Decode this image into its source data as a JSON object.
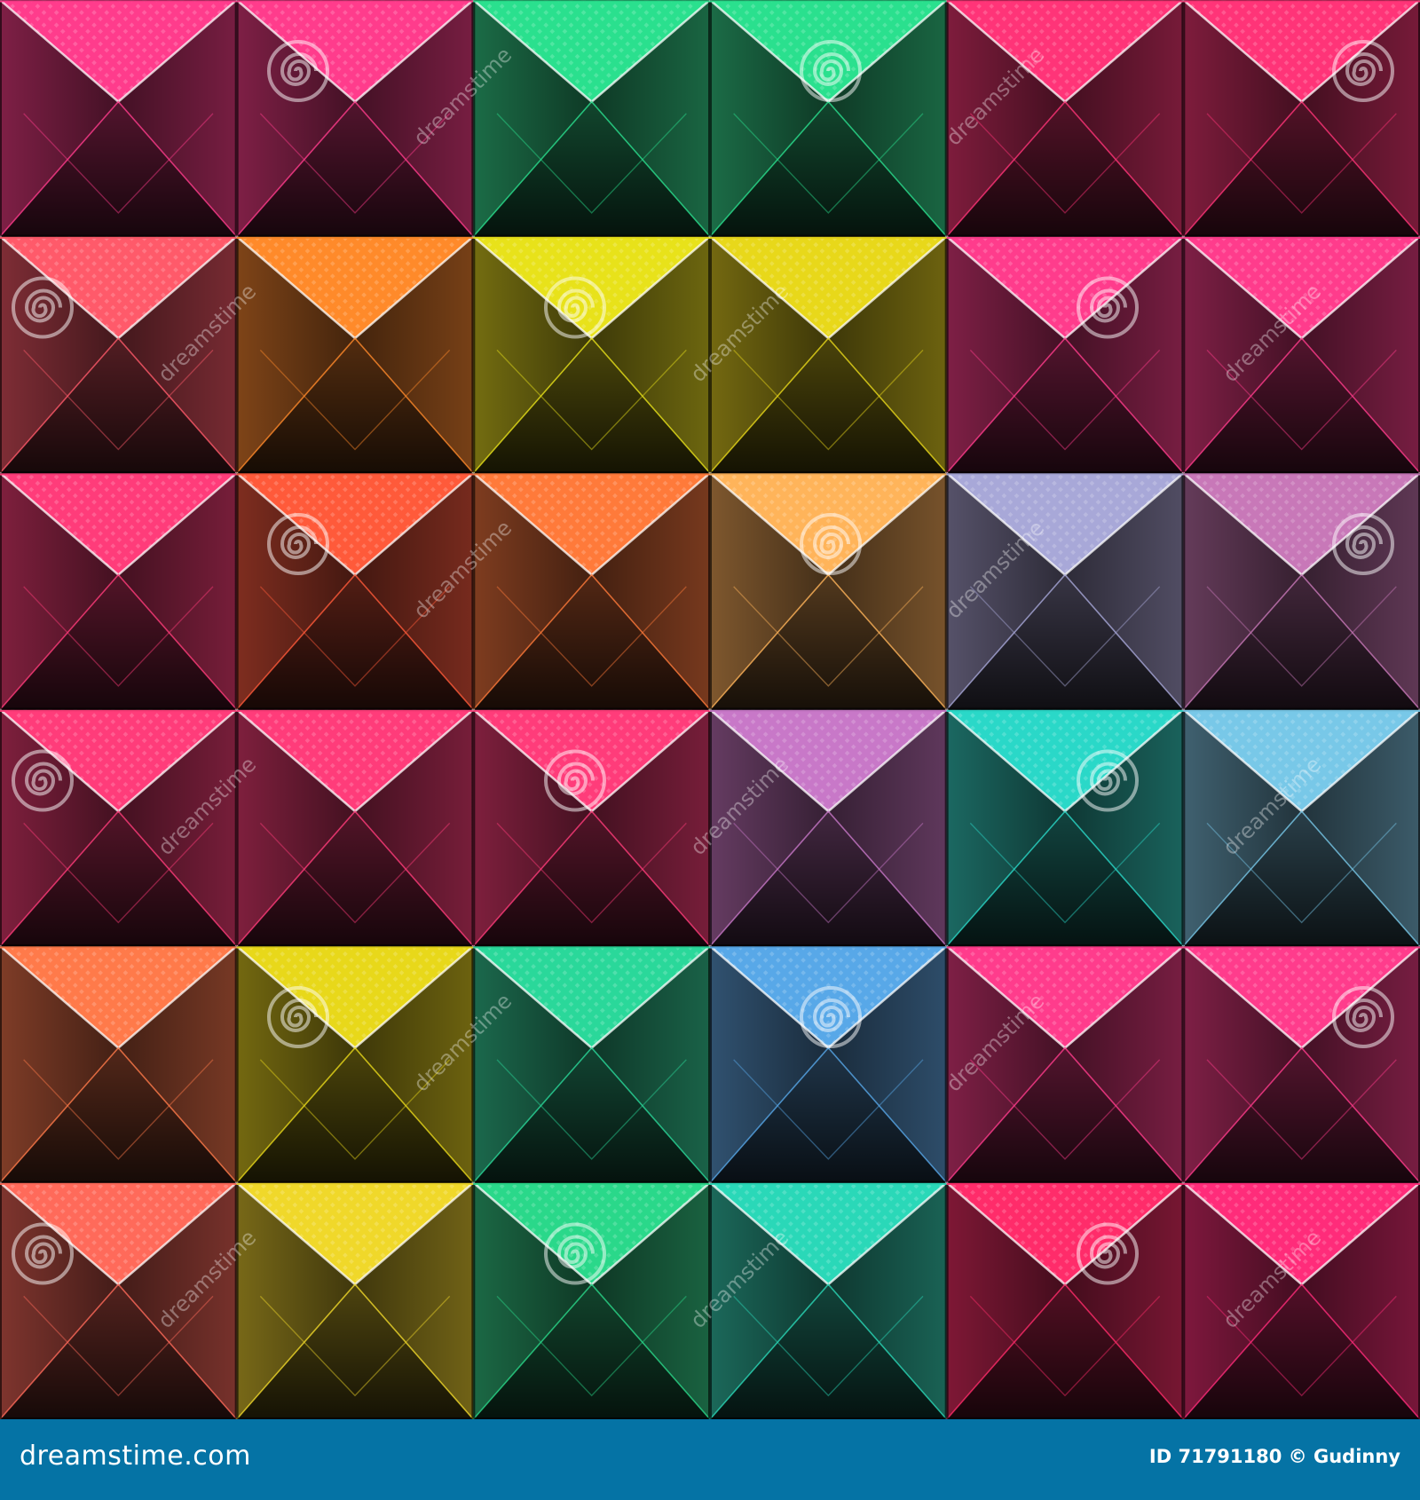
{
  "image": {
    "subject": "tiled glowing pyramid studs",
    "grid": {
      "columns": 6,
      "rows": 6
    },
    "background_color": "#140a0d",
    "tile_colors": [
      [
        "#ff3c8c",
        "#ff3c8c",
        "#2ae08e",
        "#2ae08e",
        "#ff3478",
        "#ff3478"
      ],
      [
        "#ff5a6a",
        "#ff8a2a",
        "#e8e21a",
        "#e8d81a",
        "#ff3c8c",
        "#ff3c8c"
      ],
      [
        "#ff3c7a",
        "#ff5a3a",
        "#ff7a3a",
        "#ffb45a",
        "#a8a8d8",
        "#c878b8"
      ],
      [
        "#ff3c7a",
        "#ff3c7a",
        "#ff3c7a",
        "#c878c8",
        "#2ad8c8",
        "#78c8e8"
      ],
      [
        "#ff7a4a",
        "#e8d81a",
        "#2ad89a",
        "#58a8e8",
        "#ff3c8c",
        "#ff3c8c"
      ],
      [
        "#ff6a5a",
        "#f0d82a",
        "#2ad88a",
        "#2ad8b8",
        "#ff2c6a",
        "#ff2c7a"
      ]
    ]
  },
  "watermark": {
    "text": "dreamstime",
    "icon": "spiral-logo-icon",
    "color": "#ffffff"
  },
  "footer": {
    "site_text": "dreamstime.com",
    "credit_text": "ID 71791180 © Gudinny",
    "background_color": "#0573a5"
  }
}
